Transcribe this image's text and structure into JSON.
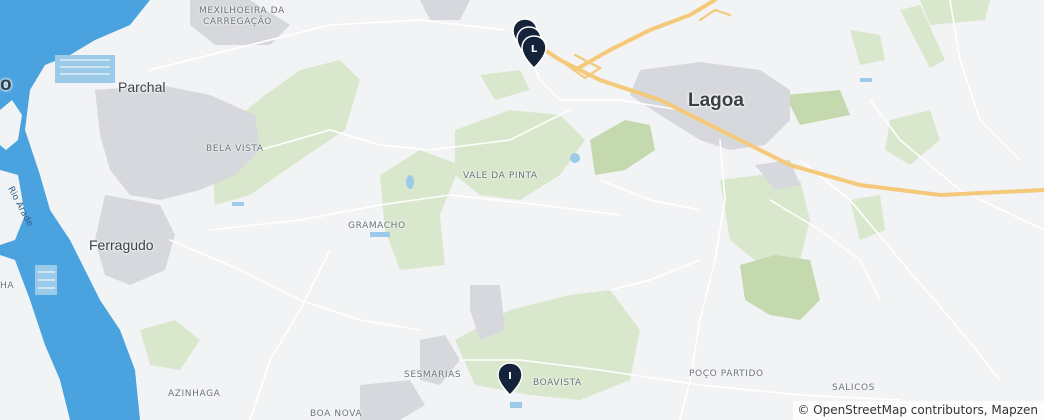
{
  "map": {
    "colors": {
      "land": "#f2f3f5",
      "water": "#4aa3df",
      "water_light": "#9ccbe9",
      "green": "#d6e6c9",
      "green_dark": "#bed5a6",
      "urban": "#d3d5da",
      "motorway": "#f4c97a",
      "road": "#ffffff",
      "marker": "#15233a"
    },
    "labels": {
      "mexilhoeira_line1": "MEXILHOEIRA DA",
      "mexilhoeira_line2": "CARREGAÇÃO",
      "parchal": "Parchal",
      "bela_vista": "BELA VISTA",
      "vale_da_pinta": "VALE DA PINTA",
      "gramacho": "GRAMACHO",
      "ferragudo": "Ferragudo",
      "lagoa": "Lagoa",
      "sesmarias": "SESMARIAS",
      "boavista": "BOAVISTA",
      "poco_partido": "POÇO PARTIDO",
      "salicos": "SALICOS",
      "azinhaga": "AZINHAGA",
      "boa_nova": "BOA NOVA",
      "rio_arade": "Rio Arade",
      "partial_left_top": "o",
      "partial_left_mid": "HA"
    },
    "markers": [
      {
        "letter": "",
        "icon": "map-pin-icon"
      },
      {
        "letter": "",
        "icon": "map-pin-icon"
      },
      {
        "letter": "L",
        "icon": "map-pin-icon"
      },
      {
        "letter": "I",
        "icon": "map-pin-icon"
      }
    ],
    "attribution": "© OpenStreetMap contributors, Mapzen"
  }
}
